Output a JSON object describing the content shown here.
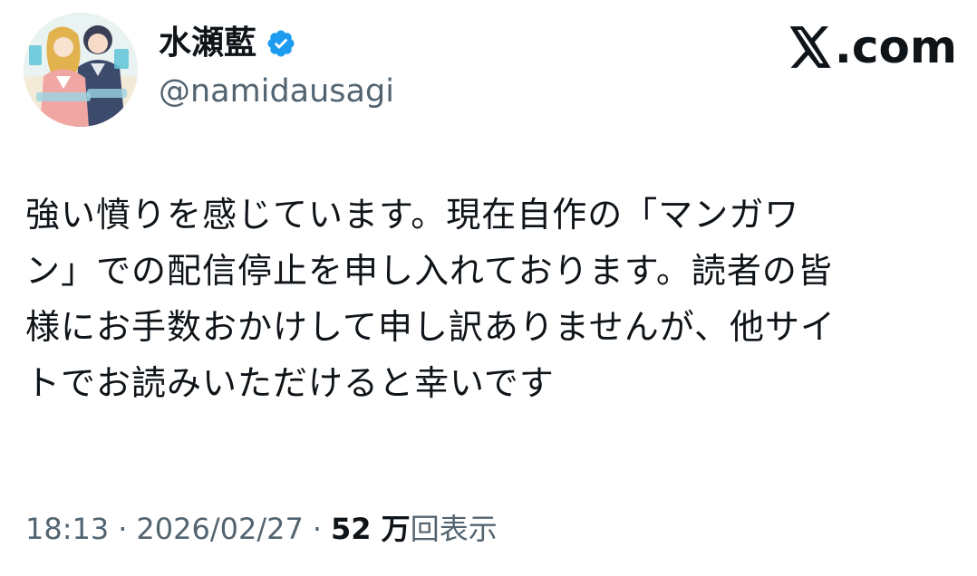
{
  "author": {
    "display_name": "水瀬藍",
    "handle": "@namidausagi",
    "verified": true,
    "verified_color": "#1d9bf0",
    "avatar_icon": "manga-cover-avatar-icon"
  },
  "brand": {
    "logo_icon": "x-logo-icon",
    "text": ".com"
  },
  "tweet": {
    "lines": [
      "強い憤りを感じています。現在自作の「マンガワ",
      "ン」での配信停止を申し入れております。読者の皆",
      "様にお手数おかけして申し訳ありませんが、他サイ",
      "トでお読みいただけると幸いです"
    ]
  },
  "meta": {
    "time": "18:13",
    "separator": "·",
    "date": "2026/02/27",
    "views_count": "52 万",
    "views_label": "回表示"
  },
  "colors": {
    "text": "#0f1419",
    "secondary": "#536471",
    "background": "#ffffff"
  }
}
